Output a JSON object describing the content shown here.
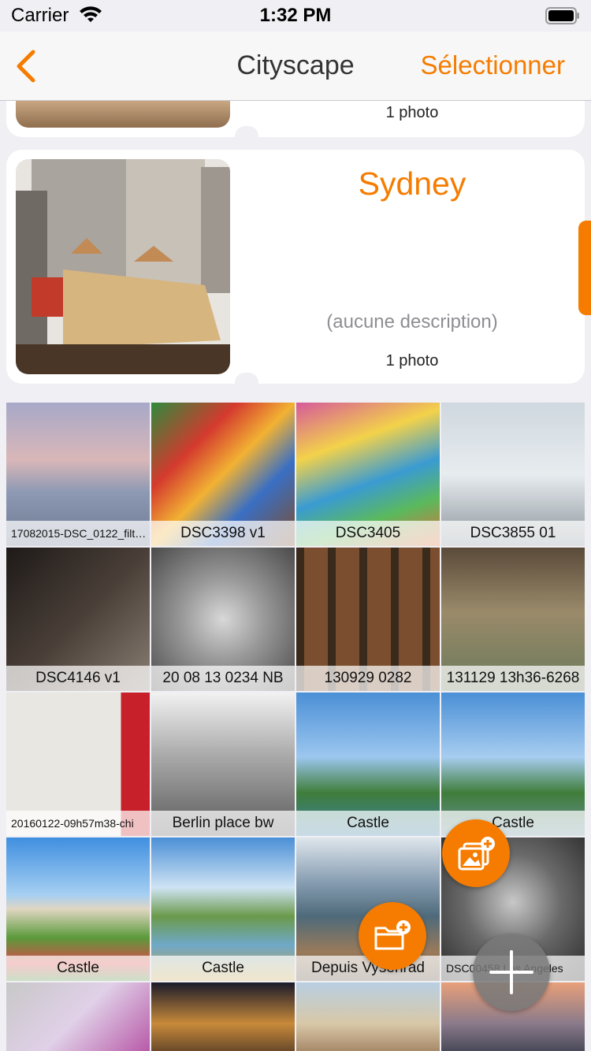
{
  "status": {
    "carrier": "Carrier",
    "time": "1:32 PM"
  },
  "nav": {
    "title": "Cityscape",
    "select_label": "Sélectionner"
  },
  "albums": [
    {
      "title": "",
      "count": "1 photo"
    },
    {
      "title": "Sydney",
      "description": "(aucune description)",
      "count": "1 photo"
    }
  ],
  "photos": [
    {
      "label": "17082015-DSC_0122_filt…"
    },
    {
      "label": "DSC3398 v1"
    },
    {
      "label": "DSC3405"
    },
    {
      "label": "DSC3855 01"
    },
    {
      "label": "DSC4146 v1"
    },
    {
      "label": "20 08 13 0234 NB"
    },
    {
      "label": "130929 0282"
    },
    {
      "label": "131129 13h36-6268"
    },
    {
      "label": "20160122-09h57m38-chi"
    },
    {
      "label": "Berlin place bw"
    },
    {
      "label": "Castle"
    },
    {
      "label": "Castle"
    },
    {
      "label": "Castle"
    },
    {
      "label": "Castle"
    },
    {
      "label": "Depuis Vyšehrad"
    },
    {
      "label": "DSC00458 Los Angeles"
    },
    {
      "label": ""
    },
    {
      "label": ""
    },
    {
      "label": ""
    },
    {
      "label": ""
    }
  ],
  "colors": {
    "accent": "#f57c00",
    "fab_neutral": "#787878"
  }
}
